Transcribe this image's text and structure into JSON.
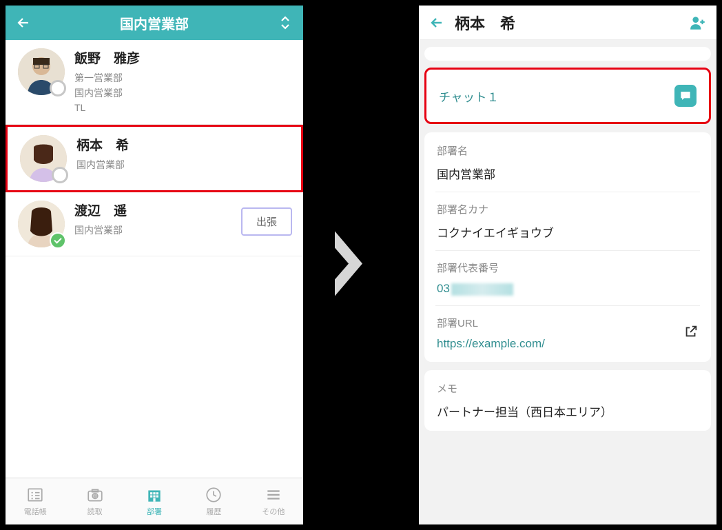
{
  "left": {
    "header_title": "国内営業部",
    "contacts": [
      {
        "name": "飯野　雅彦",
        "lines": [
          "第一営業部",
          "国内営業部",
          "TL"
        ],
        "status": "none",
        "highlight": false,
        "away": false
      },
      {
        "name": "柄本　希",
        "lines": [
          "国内営業部"
        ],
        "status": "none",
        "highlight": true,
        "away": false
      },
      {
        "name": "渡辺　遥",
        "lines": [
          "国内営業部"
        ],
        "status": "green",
        "highlight": false,
        "away": true
      }
    ],
    "away_label": "出張",
    "tabs": [
      {
        "label": "電話帳",
        "active": false,
        "name": "tab-contacts"
      },
      {
        "label": "読取",
        "active": false,
        "name": "tab-scan"
      },
      {
        "label": "部署",
        "active": true,
        "name": "tab-department"
      },
      {
        "label": "履歴",
        "active": false,
        "name": "tab-history"
      },
      {
        "label": "その他",
        "active": false,
        "name": "tab-other"
      }
    ]
  },
  "right": {
    "header_title": "柄本　希",
    "chat_label": "チャット１",
    "dept_label": "部署名",
    "dept_value": "国内営業部",
    "dept_kana_label": "部署名カナ",
    "dept_kana_value": "コクナイエイギョウブ",
    "phone_label": "部署代表番号",
    "phone_prefix": "03",
    "url_label": "部署URL",
    "url_value": "https://example.com/",
    "memo_label": "メモ",
    "memo_value": "パートナー担当（西日本エリア）"
  }
}
